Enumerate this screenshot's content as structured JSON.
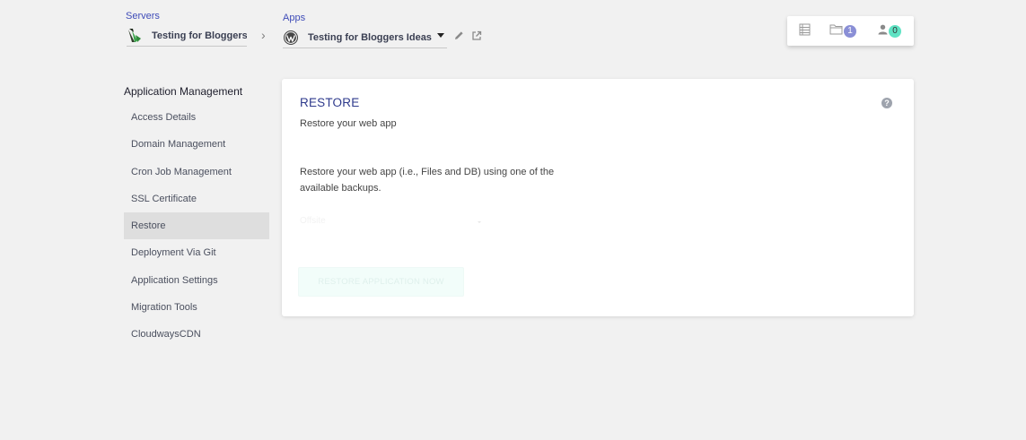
{
  "breadcrumb": {
    "servers_label": "Servers",
    "server_name": "Testing for Bloggers I",
    "apps_label": "Apps",
    "app_name": "Testing for Bloggers Ideas"
  },
  "top_right": {
    "folder_count": "1",
    "user_count": "0",
    "folder_badge_color": "#8a8fd6",
    "user_badge_color": "#5fe3c4"
  },
  "sidebar": {
    "title": "Application Management",
    "items": [
      {
        "label": "Access Details"
      },
      {
        "label": "Domain Management"
      },
      {
        "label": "Cron Job Management"
      },
      {
        "label": "SSL Certificate"
      },
      {
        "label": "Restore",
        "active": true
      },
      {
        "label": "Deployment Via Git"
      },
      {
        "label": "Application Settings"
      },
      {
        "label": "Migration Tools"
      },
      {
        "label": "CloudwaysCDN"
      }
    ]
  },
  "content": {
    "title": "RESTORE",
    "subtitle": "Restore your web app",
    "description": "Restore your web app (i.e., Files and DB) using one of the available backups.",
    "backup_select_value": "Offsite",
    "restore_button_label": "RESTORE APPLICATION NOW"
  },
  "colors": {
    "accent": "#3f4cb8",
    "title": "#2e3a8c",
    "background": "#f1f1f1",
    "active_sidebar": "#dedede"
  },
  "icons": {
    "server": "cloudways-server-icon",
    "app": "wordpress-icon",
    "edit": "pencil-icon",
    "open": "external-link-icon",
    "list": "list-icon",
    "folder": "folder-icon",
    "user": "user-icon",
    "help": "help-icon"
  }
}
